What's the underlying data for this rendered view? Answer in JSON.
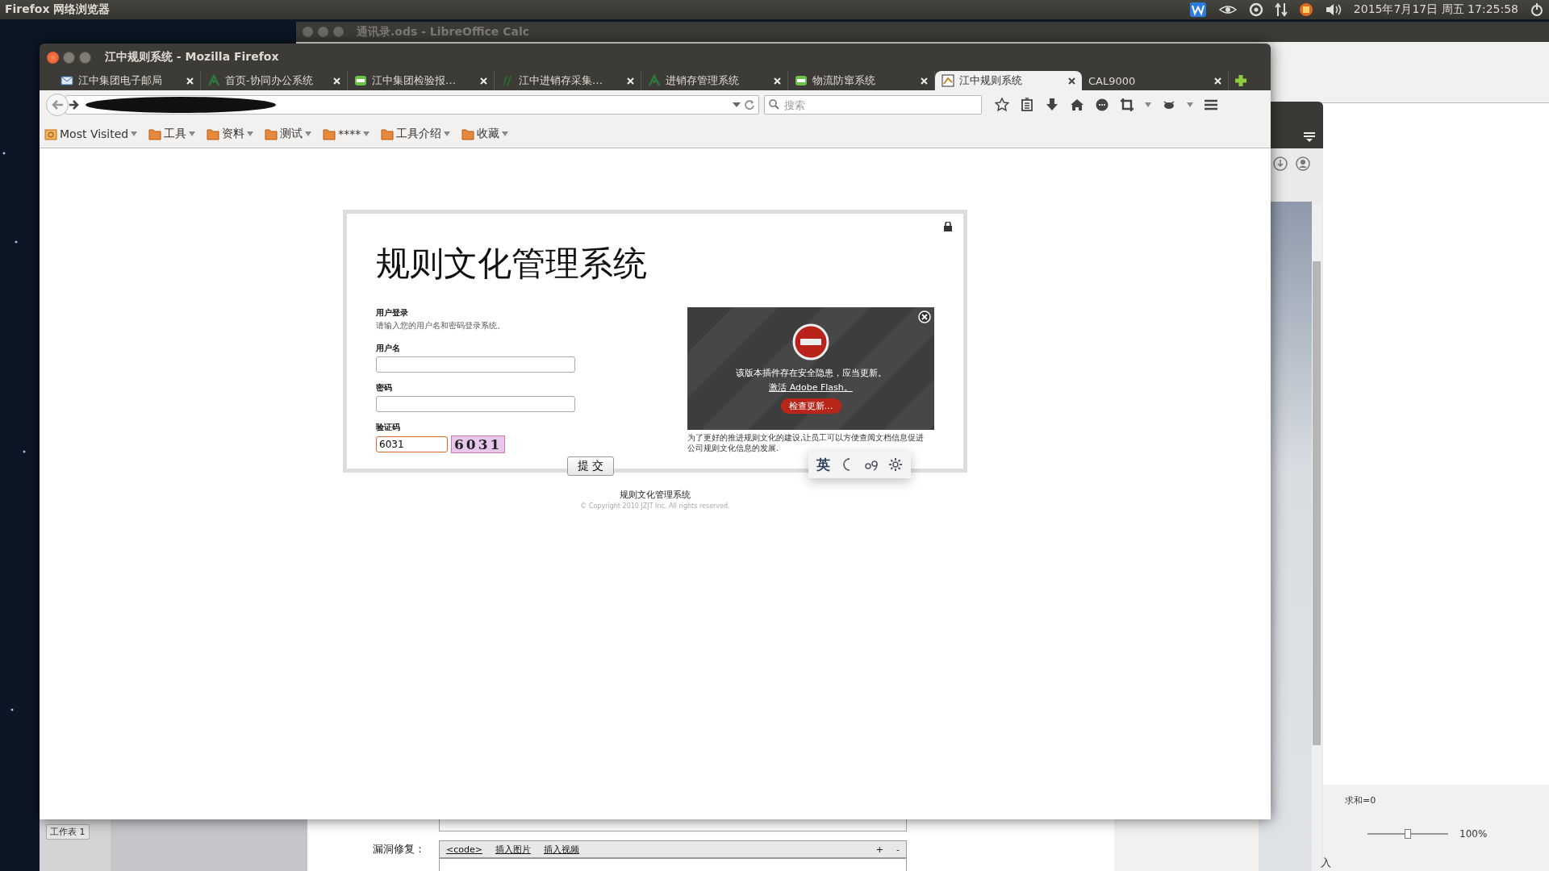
{
  "top_panel": {
    "app_name": "Firefox 网络浏览器",
    "clock": "2015年7月17日 周五 17:25:58"
  },
  "background_window": {
    "title": "通讯录.ods - LibreOffice Calc",
    "sheet_tab": "工作表 1",
    "status": "求和=0",
    "zoom": "100%",
    "zoom_slider": {
      "level": 0.5
    }
  },
  "editor_window": {
    "label": "漏洞修复：",
    "toolbar": [
      "<code>",
      "插入图片",
      "插入视频"
    ],
    "actions": [
      "+",
      "-"
    ],
    "side_text": "入"
  },
  "browser": {
    "title": "江中规则系统 - Mozilla Firefox",
    "tabs": [
      {
        "label": "江中集团电子邮局",
        "selected": false
      },
      {
        "label": "首页-协同办公系统",
        "selected": false
      },
      {
        "label": "江中集团检验报…",
        "selected": false
      },
      {
        "label": "江中进销存采集…",
        "selected": false
      },
      {
        "label": "进销存管理系统",
        "selected": false
      },
      {
        "label": "物流防窜系统",
        "selected": false
      },
      {
        "label": "江中规则系统",
        "selected": true
      },
      {
        "label": "CAL9000",
        "selected": false
      }
    ],
    "search": {
      "placeholder": "搜索"
    },
    "bookmarks": [
      {
        "label": "Most Visited",
        "kind": "history"
      },
      {
        "label": "工具",
        "kind": "folder"
      },
      {
        "label": "资料",
        "kind": "folder"
      },
      {
        "label": "测试",
        "kind": "folder"
      },
      {
        "label": "****",
        "kind": "folder"
      },
      {
        "label": "工具介绍",
        "kind": "folder"
      },
      {
        "label": "收藏",
        "kind": "folder"
      }
    ]
  },
  "page": {
    "heading": "规则文化管理系统",
    "login": {
      "title": "用户登录",
      "hint": "请输入您的用户名和密码登录系统。",
      "fields": [
        {
          "label": "用户名",
          "focused": false
        },
        {
          "label": "密码",
          "focused": false
        }
      ],
      "captcha": {
        "label": "验证码",
        "value": "6031",
        "focused": true,
        "image_text": "6031"
      },
      "submit": "提 交"
    },
    "plugin": {
      "message": "该版本插件存在安全隐患，应当更新。",
      "link": "激活 Adobe Flash。",
      "button": "检查更新…"
    },
    "description": "为了更好的推进规则文化的建设,让员工可以方便查阅文档信息促进公司规则文化信息的发展.",
    "footer": {
      "title": "规则文化管理系统",
      "copyright": "© Copyright 2010 JZJT Inc. All rights reserved."
    }
  },
  "ime_toolbar": {
    "language": "英"
  }
}
